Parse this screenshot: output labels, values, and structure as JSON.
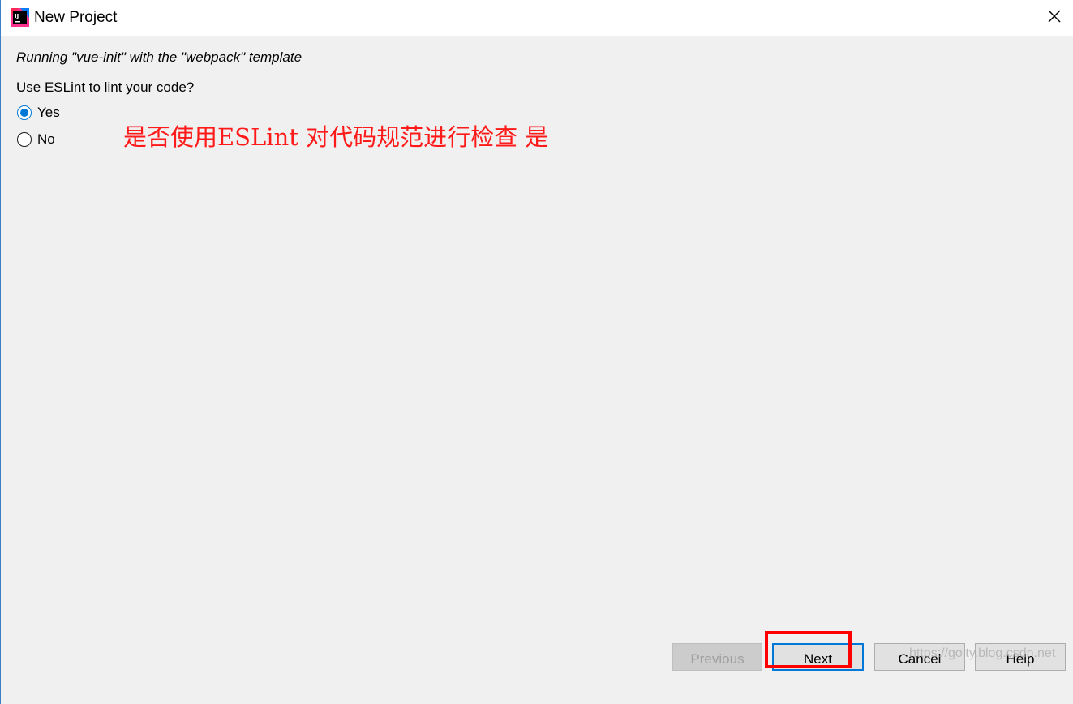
{
  "window": {
    "title": "New Project"
  },
  "content": {
    "subtitle": "Running \"vue-init\" with the \"webpack\" template",
    "question": "Use ESLint to lint your code?",
    "options": [
      {
        "label": "Yes",
        "selected": true
      },
      {
        "label": "No",
        "selected": false
      }
    ],
    "annotation": "是否使用ESLint 对代码规范进行检查 是"
  },
  "footer": {
    "previous_label": "Previous",
    "next_label": "Next",
    "cancel_label": "Cancel",
    "help_label": "Help",
    "previous_enabled": false
  },
  "watermark": "https://goity.blog.csdn.net",
  "colors": {
    "accent": "#0078d7",
    "annotation": "#ff1a1a",
    "highlight": "#ff0000"
  }
}
